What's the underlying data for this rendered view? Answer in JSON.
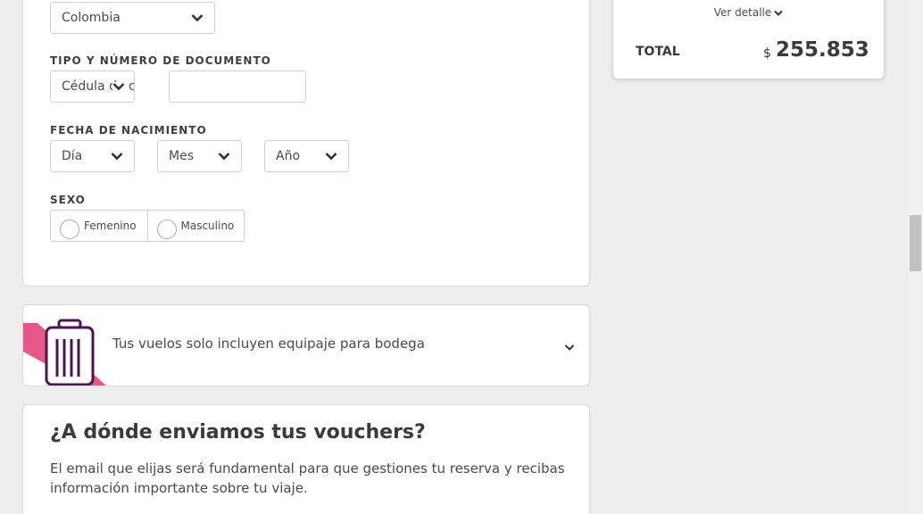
{
  "form": {
    "country_value": "Colombia",
    "document_label": "TIPO Y NÚMERO DE DOCUMENTO",
    "document_type_value": "Cédula de ciudadanía",
    "document_number_value": "",
    "birthdate_label": "FECHA DE NACIMIENTO",
    "day_value": "Día",
    "month_value": "Mes",
    "year_value": "Año",
    "sex_label": "SEXO",
    "sex_options": [
      "Femenino",
      "Masculino"
    ]
  },
  "baggage": {
    "text": "Tus vuelos solo incluyen equipaje para bodega",
    "icon": "suitcase-icon"
  },
  "voucher": {
    "title": "¿A dónde enviamos tus vouchers?",
    "description": "El email que elijas será fundamental para que gestiones tu reserva y recibas información importante sobre tu viaje."
  },
  "summary": {
    "detail_label": "Ver detalle",
    "total_label": "TOTAL",
    "currency": "$",
    "total_amount": "255.853"
  },
  "colors": {
    "accent_pink": "#e8578b",
    "suitcase_purple": "#4b1552",
    "background": "#eeeeee"
  }
}
